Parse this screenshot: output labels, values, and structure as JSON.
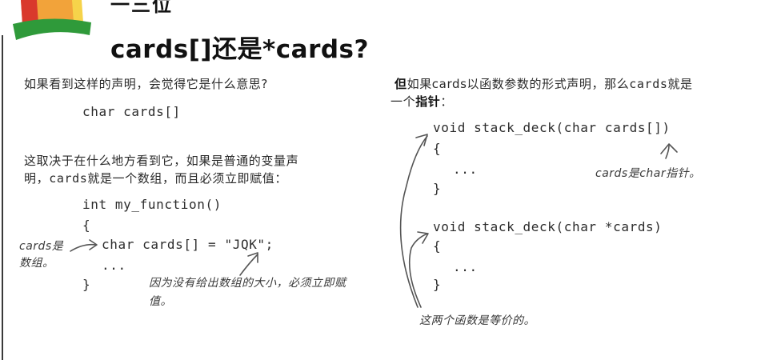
{
  "header": {
    "partial_heading": "一三位",
    "title": "cards[]还是*cards?"
  },
  "left": {
    "question": "如果看到这样的声明，会觉得它是什么意思?",
    "code_decl": "char cards[]",
    "explanation_line1": "这取决于在什么地方看到它，如果是普通的变量声",
    "explanation_line2_pre": "明，",
    "explanation_line2_mono": "cards",
    "explanation_line2_post": "就是一个数组，而且必须立即赋值：",
    "code_func_sig": "int my_function()",
    "code_open_brace": "{",
    "code_assign": "char cards[] = \"JQK\";",
    "code_ellipsis": "...",
    "code_close_brace": "}",
    "note_array_line1": "cards是",
    "note_array_line2": "数组。",
    "note_size_line1": "因为没有给出数组的大小，必须立即赋",
    "note_size_line2": "值。"
  },
  "right": {
    "intro_strong1": "但",
    "intro_pre": "如果cards以函数参数的形式声明，那么",
    "intro_mono": "cards",
    "intro_post": "就是",
    "intro_line2_pre": "一个",
    "intro_line2_strong": "指针",
    "intro_line2_post": "：",
    "code1_sig": "void stack_deck(char cards[])",
    "code1_open": "{",
    "code1_body": "...",
    "code1_close": "}",
    "code2_sig": "void stack_deck(char *cards)",
    "code2_open": "{",
    "code2_body": "...",
    "code2_close": "}",
    "note_pointer": "cards是char指针。",
    "note_equivalent": "这两个函数是等价的。"
  },
  "colors": {
    "hat_red": "#d9392c",
    "hat_orange": "#f2a33a",
    "hat_yellow": "#f6d34a",
    "hat_green": "#2f9a3a",
    "ink": "#555555"
  }
}
